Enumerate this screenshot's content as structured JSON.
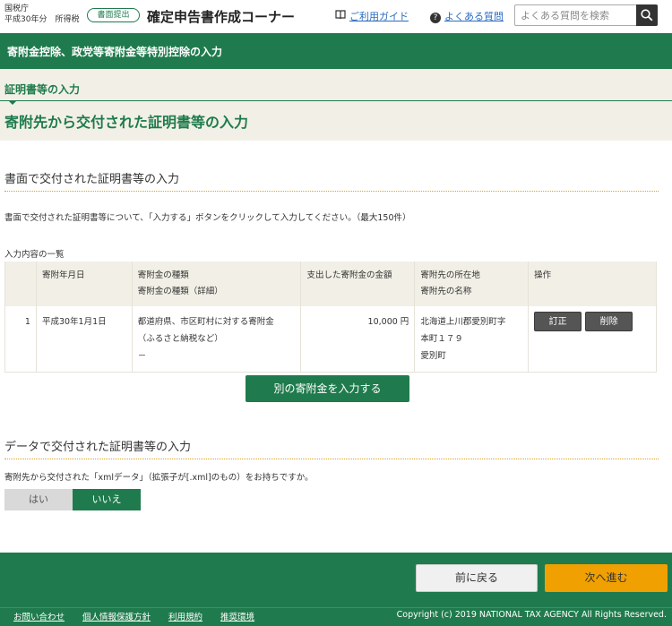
{
  "header": {
    "agency_line1": "国税庁",
    "agency_line2": "平成30年分　所得税",
    "badge": "書面提出",
    "title": "確定申告書作成コーナー",
    "guide_link": "ご利用ガイド",
    "faq_link": "よくある質問",
    "search_placeholder": "よくある質問を検索"
  },
  "section_bar": "寄附金控除、政党等寄附金等特別控除の入力",
  "sub_label": "証明書等の入力",
  "page_heading": "寄附先から交付された証明書等の入力",
  "paper_section": {
    "title": "書面で交付された証明書等の入力",
    "description": "書面で交付された証明書等について、「入力する」ボタンをクリックして入力してください。（最大150件）",
    "list_label": "入力内容の一覧",
    "table": {
      "headers": {
        "date": "寄附年月日",
        "kind_1": "寄附金の種類",
        "kind_2": "寄附金の種類（詳細）",
        "amount": "支出した寄附金の金額",
        "place_1": "寄附先の所在地",
        "place_2": "寄附先の名称",
        "ops": "操作"
      },
      "rows": [
        {
          "index": "1",
          "date": "平成30年1月1日",
          "kind_1": "都道府県、市区町村に対する寄附金",
          "kind_2": "（ふるさと納税など）",
          "kind_3": "－",
          "amount": "10,000 円",
          "place_1": "北海道上川郡愛別町字",
          "place_2": "本町１７９",
          "place_3": "愛別町",
          "edit": "訂正",
          "delete": "削除"
        }
      ]
    },
    "add_button": "別の寄附金を入力する"
  },
  "data_section": {
    "title": "データで交付された証明書等の入力",
    "question": "寄附先から交付された「xmlデータ」（拡張子が[.xml]のもの）をお持ちですか。",
    "yes": "はい",
    "no": "いいえ",
    "selected": "いいえ"
  },
  "footer": {
    "back": "前に戻る",
    "next": "次へ進む",
    "links": [
      "お問い合わせ",
      "個人情報保護方針",
      "利用規約",
      "推奨環境"
    ],
    "copyright": "Copyright (c) 2019 NATIONAL TAX AGENCY All Rights Reserved."
  },
  "colors": {
    "primary": "#1f7b4d",
    "accent": "#f0a000",
    "beige": "#f2f0e6"
  }
}
